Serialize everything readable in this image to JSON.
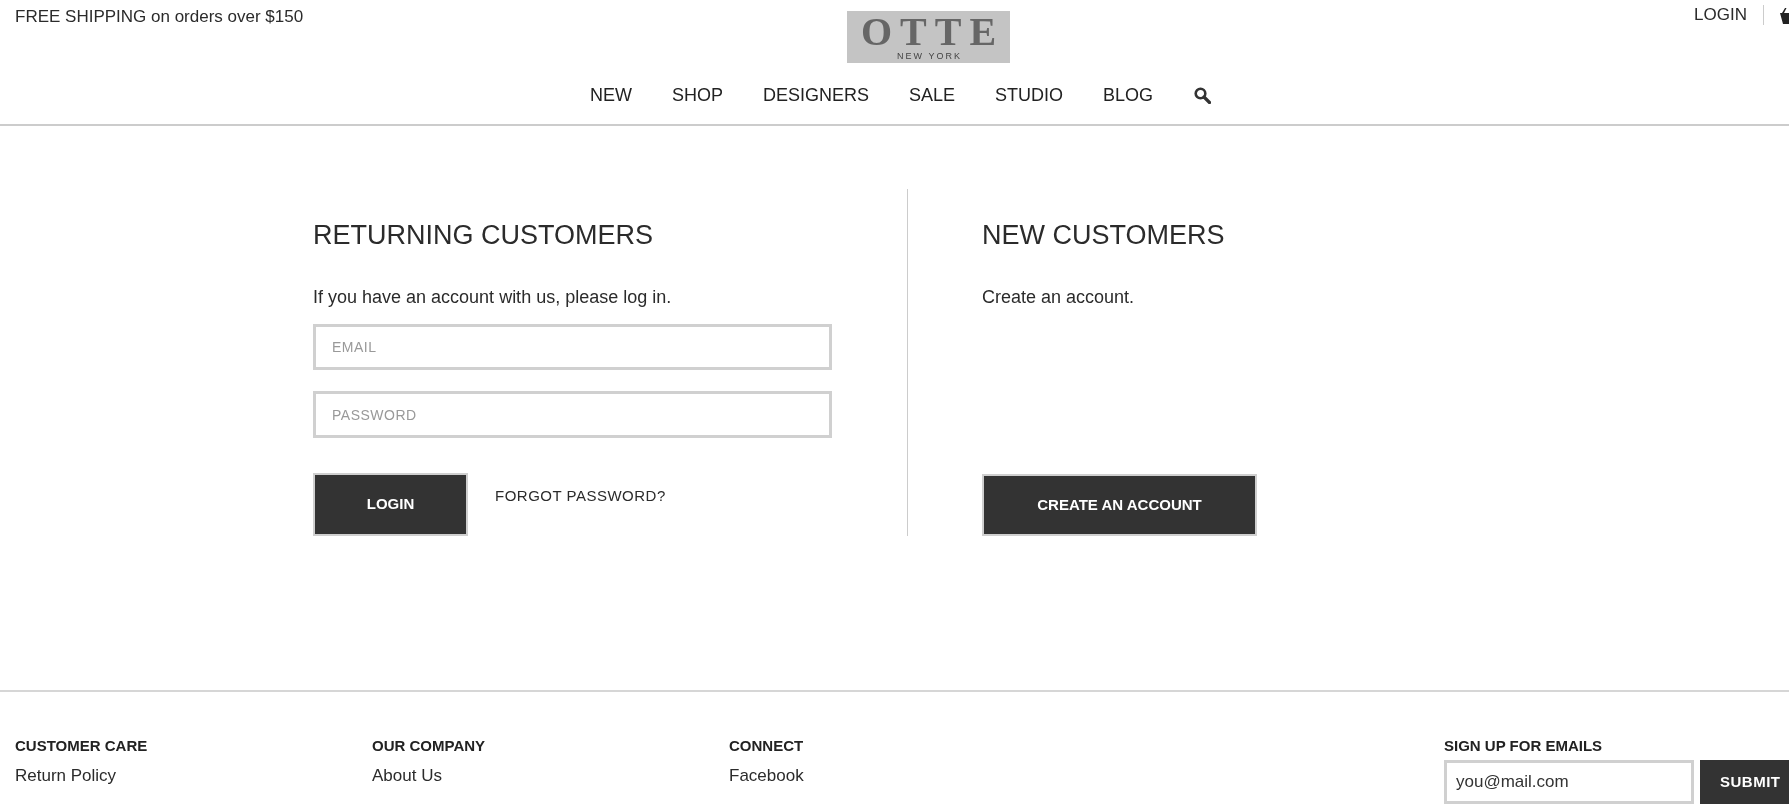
{
  "promo_bar": {
    "text": "FREE SHIPPING on orders over $150"
  },
  "logo": {
    "wordmark": "OTTE",
    "subtitle": "NEW YORK"
  },
  "account": {
    "login": "LOGIN"
  },
  "nav": {
    "items": [
      {
        "label": "NEW"
      },
      {
        "label": "SHOP"
      },
      {
        "label": "DESIGNERS"
      },
      {
        "label": "SALE"
      },
      {
        "label": "STUDIO"
      },
      {
        "label": "BLOG"
      }
    ]
  },
  "returning_customers": {
    "title": "RETURNING CUSTOMERS",
    "text": "If you have an account with us, please log in.",
    "fields": [
      {
        "placeholder": "EMAIL"
      },
      {
        "placeholder": "PASSWORD"
      }
    ],
    "login_button": "LOGIN",
    "forgot_link": "FORGOT PASSWORD?"
  },
  "new_customers": {
    "title": "NEW CUSTOMERS",
    "text": "Create an account.",
    "button": "CREATE AN ACCOUNT"
  },
  "footer": {
    "columns": [
      {
        "heading": "CUSTOMER CARE",
        "links": [
          "Return Policy"
        ]
      },
      {
        "heading": "OUR COMPANY",
        "links": [
          "About Us"
        ]
      },
      {
        "heading": "CONNECT",
        "links": [
          "Facebook"
        ]
      }
    ],
    "newsletter": {
      "heading": "SIGN UP FOR EMAILS",
      "value": "you@mail.com",
      "button": "SUBMIT"
    }
  }
}
